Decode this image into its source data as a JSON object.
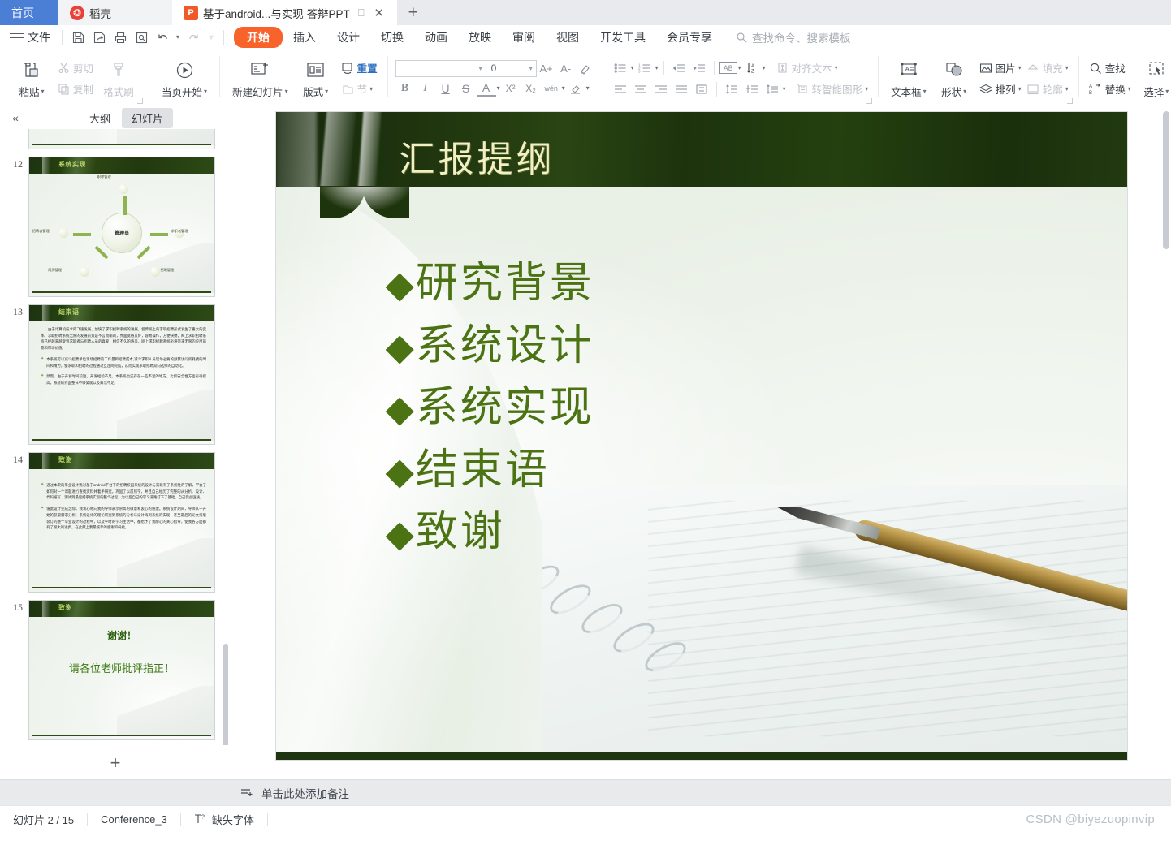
{
  "tabbar": {
    "home_label": "首页",
    "docer_label": "稻壳",
    "doc_label": "基于android...与实现 答辩PPT",
    "doc_icon": "powerpoint-icon",
    "new_tab": "+"
  },
  "menubar": {
    "file_label": "文件",
    "quick_access": [
      "save-icon",
      "save-as-icon",
      "print-icon",
      "print-preview-icon",
      "undo-icon",
      "redo-icon",
      "customize-icon"
    ],
    "items": [
      {
        "label": "开始",
        "selected": true
      },
      {
        "label": "插入",
        "selected": false
      },
      {
        "label": "设计",
        "selected": false
      },
      {
        "label": "切换",
        "selected": false
      },
      {
        "label": "动画",
        "selected": false
      },
      {
        "label": "放映",
        "selected": false
      },
      {
        "label": "审阅",
        "selected": false
      },
      {
        "label": "视图",
        "selected": false
      },
      {
        "label": "开发工具",
        "selected": false
      },
      {
        "label": "会员专享",
        "selected": false
      }
    ],
    "search_placeholder": "查找命令、搜索模板"
  },
  "ribbon": {
    "paste": "粘贴",
    "cut": "剪切",
    "copy": "复制",
    "format_painter": "格式刷",
    "start_from_page": "当页开始",
    "new_slide": "新建幻灯片",
    "layout": "版式",
    "reset": "重置",
    "section": "节",
    "font_name_value": "",
    "font_size_value": "0",
    "grow_font": "A+",
    "shrink_font": "A-",
    "clear_format": "clear-format-icon",
    "bold": "B",
    "italic": "I",
    "underline": "U",
    "strikethrough": "S",
    "font_color": "A",
    "superscript": "X²",
    "subscript": "X₂",
    "phonetic": "wén",
    "highlight": "highlight-icon",
    "bullets": "bullet-list-icon",
    "numbering": "numbered-list-icon",
    "decrease_indent": "decrease-indent-icon",
    "increase_indent": "increase-indent-icon",
    "text_direction": "AB",
    "sort": "sort-icon",
    "align_text": "对齐文本",
    "line_spacing": "line-spacing-icon",
    "convert_smartart": "转智能图形",
    "textbox": "文本框",
    "shape": "形状",
    "picture": "图片",
    "arrange": "排列",
    "fill": "填充",
    "outline": "轮廓",
    "find": "查找",
    "replace": "替换",
    "select": "选择"
  },
  "leftpanel": {
    "collapse_icon": "collapse-left-icon",
    "tabs": [
      {
        "label": "大纲",
        "selected": false
      },
      {
        "label": "幻灯片",
        "selected": true
      }
    ],
    "add_slide": "+",
    "slides": [
      {
        "number": "12",
        "title": "系统实现",
        "type": "diagram",
        "center": "管理员",
        "nodes": [
          "职称管理",
          "招聘者管理",
          "求职者管理",
          "简历管理",
          "招聘管理"
        ]
      },
      {
        "number": "13",
        "title": "结束语",
        "type": "text",
        "paragraphs": [
          "由于计算机技术的飞速发展，加快了求职招聘系统的进展，使传统上的求职招聘形式发生了重大的变革。求职招聘系统无限的发展前景是不言而喻的，界面宽裕友好，容易操作，方便快捷，网上求职招聘系统已经越来越受到求职者与招聘人员的喜爱，相信不久的将来，网上求职招聘系统必将带来无限的应用前景和市场价值。",
          "本系统可以减少招聘单位现场招聘的工作量和招聘成本,减少求职人员现场必要的频繁访问所耗费的时间和精力，使求职和招聘的过程通过互连网完成，从而实现求职招聘双向选择的自动化。",
          "然而，由于开发时间较短，开发经验不足，本系统也还存在一些不足的地方，比如安全性方面有待提高，系统的界面整体不够美观以及鲜活不足。"
        ]
      },
      {
        "number": "14",
        "title": "致谢",
        "type": "text",
        "paragraphs": [
          "通过本次的毕业设计我对基于android平台下的招聘校园系统的设计与实现有了系统性的了解，学会了如何对一个课题进行查找资料并着手研究，巩固了以前所学，并且自己经历了完整的从分析、设计、代码编写、测试到最后把系统实现的整个过程，为以后自己的学习道路打下了基础，自己受益匪浅。",
          "值此设计完成之际，我衷心地向我的导师表示崇高的敬意和衷心的感激。系统设计期间，导师从一开始的获取需求分析、系统设计的理论研究到系统的分析与设计再到系统的实现，甚至最后的论文排版装订的整个毕业设计的过程中，以及平时的学习生活中，都给予了我耐心的关心指导，使我各方面都有了很大的进步，在此献上我最诚挚的感谢和祝福。"
        ]
      },
      {
        "number": "15",
        "title": "致谢",
        "type": "thanks",
        "thanks_line1": "谢谢！",
        "thanks_line2": "请各位老师批评指正！"
      }
    ]
  },
  "slide": {
    "title": "汇报提纲",
    "bullet_glyph": "◆",
    "bullets": [
      "研究背景",
      "系统设计",
      "系统实现",
      "结束语",
      "致谢"
    ],
    "colors": {
      "header_green": "#1e340d",
      "title_cream": "#f2f0c2",
      "bullet_green": "#4b7313",
      "footer_green": "#1f3510"
    }
  },
  "notes": {
    "icon": "add-note-icon",
    "placeholder": "单击此处添加备注"
  },
  "statusbar": {
    "slide_counter": "幻灯片 2 / 15",
    "theme": "Conference_3",
    "missing_font_icon": "missing-font-icon",
    "missing_font": "缺失字体",
    "watermark": "CSDN @biyezuopinvip"
  }
}
